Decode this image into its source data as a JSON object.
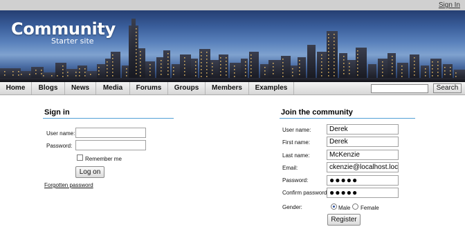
{
  "header": {
    "sign_in_link": "Sign In",
    "site_title": "Community",
    "site_subtitle": "Starter site"
  },
  "nav": {
    "items": [
      "Home",
      "Blogs",
      "News",
      "Media",
      "Forums",
      "Groups",
      "Members",
      "Examples"
    ],
    "search_value": "",
    "search_button": "Search"
  },
  "signin": {
    "title": "Sign in",
    "username_label": "User name:",
    "username_value": "",
    "password_label": "Password:",
    "password_value": "",
    "remember_label": "Remember me",
    "remember_checked": false,
    "logon_button": "Log on",
    "forgot_link": "Forgotten password"
  },
  "join": {
    "title": "Join the community",
    "username_label": "User name:",
    "username_value": "Derek",
    "firstname_label": "First name:",
    "firstname_value": "Derek",
    "lastname_label": "Last name:",
    "lastname_value": "McKenzie",
    "email_label": "Email:",
    "email_value": "ckenzie@localhost.local",
    "password_label": "Password:",
    "password_value": "●●●●●",
    "confirm_label": "Confirm password:",
    "confirm_value": "●●●●●",
    "gender_label": "Gender:",
    "gender_male": "Male",
    "gender_female": "Female",
    "gender_selected": "Male",
    "register_button": "Register"
  },
  "colors": {
    "accent_rule": "#4f9fd5",
    "topbar": "#d0d0d0"
  }
}
